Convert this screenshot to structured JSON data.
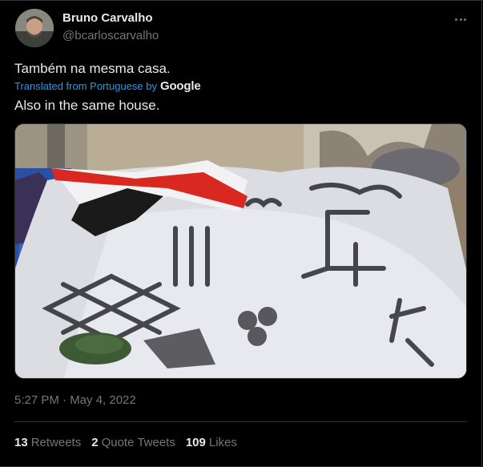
{
  "author": {
    "name": "Bruno Carvalho",
    "handle": "@bcarloscarvalho"
  },
  "tweet": {
    "original_text": "Também na mesma casa.",
    "translated_from": "Translated from Portuguese by",
    "translator": "Google",
    "translated_text": "Also in the same house.",
    "timestamp": "5:27 PM · May 4, 2022"
  },
  "stats": {
    "retweets": {
      "count": "13",
      "label": "Retweets"
    },
    "quote_tweets": {
      "count": "2",
      "label": "Quote Tweets"
    },
    "likes": {
      "count": "109",
      "label": "Likes"
    }
  },
  "colors": {
    "background": "#000000",
    "text": "#e7e9ea",
    "muted": "#71767b",
    "link": "#1d9bf0",
    "divider": "#2f3336"
  },
  "icons": {
    "more": "more-icon"
  }
}
